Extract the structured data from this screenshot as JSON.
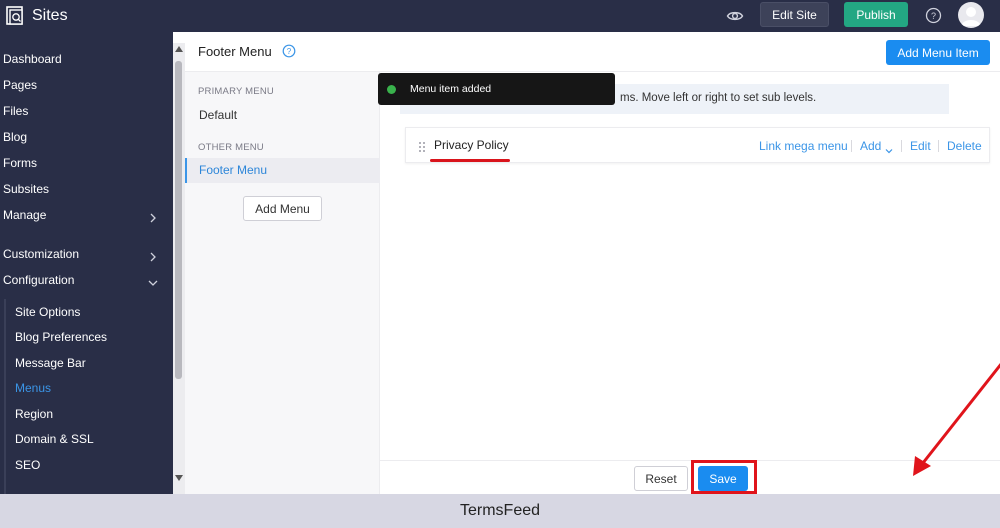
{
  "topbar": {
    "app_title": "Sites",
    "edit_site_label": "Edit Site",
    "publish_label": "Publish",
    "icons": [
      "sites-logo-icon",
      "preview-eye-icon",
      "help-icon",
      "avatar-icon"
    ]
  },
  "sidebar": {
    "items": [
      {
        "label": "Dashboard"
      },
      {
        "label": "Pages"
      },
      {
        "label": "Files"
      },
      {
        "label": "Blog"
      },
      {
        "label": "Forms"
      },
      {
        "label": "Subsites"
      },
      {
        "label": "Manage"
      },
      {
        "label": "Customization"
      },
      {
        "label": "Configuration"
      }
    ],
    "configuration_items": [
      {
        "label": "Site Options"
      },
      {
        "label": "Blog Preferences"
      },
      {
        "label": "Message Bar"
      },
      {
        "label": "Menus",
        "active": true
      },
      {
        "label": "Region"
      },
      {
        "label": "Domain & SSL"
      },
      {
        "label": "SEO"
      }
    ]
  },
  "header": {
    "title": "Footer Menu",
    "add_item_label": "Add Menu Item"
  },
  "menus": {
    "primary_section": "PRIMARY MENU",
    "primary_items": [
      "Default"
    ],
    "other_section": "OTHER MENU",
    "other_items": [
      "Footer Menu"
    ],
    "add_menu_label": "Add Menu"
  },
  "info": {
    "text": "ms. Move left or right to set sub levels."
  },
  "toast": {
    "text": "Menu item added"
  },
  "menu_item": {
    "label": "Privacy Policy",
    "actions": {
      "link_mega_menu": "Link mega menu",
      "add": "Add",
      "edit": "Edit",
      "delete": "Delete"
    }
  },
  "footer": {
    "reset_label": "Reset",
    "save_label": "Save"
  },
  "caption": {
    "text": "TermsFeed"
  },
  "colors": {
    "topbar_bg": "#292e47",
    "primary_blue": "#1a8cf0",
    "publish_green": "#23a783",
    "annotation_red": "#e0141b",
    "link_blue": "#3b95e7"
  }
}
